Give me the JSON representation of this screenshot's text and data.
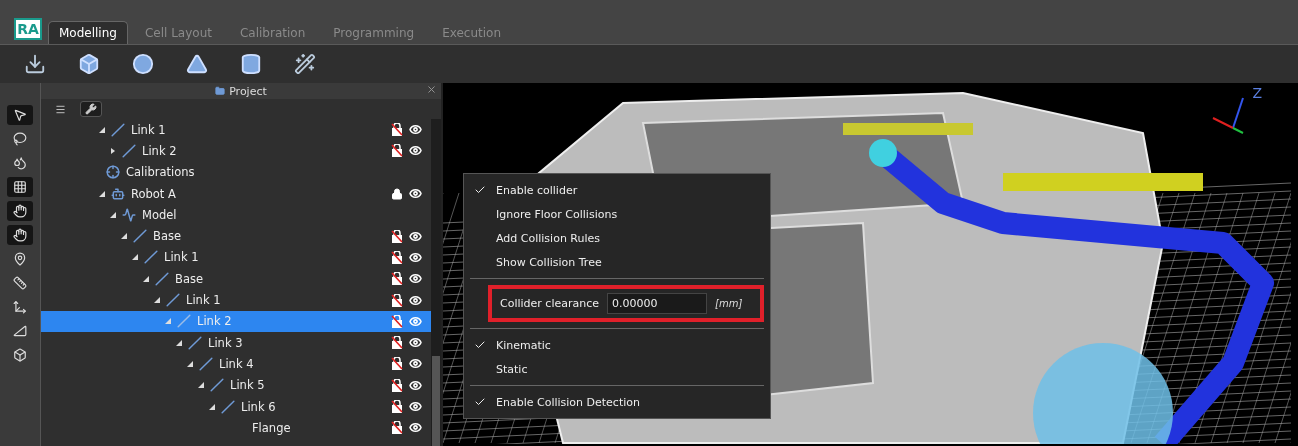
{
  "app": {
    "logo": "RA"
  },
  "tabs": [
    {
      "label": "Modelling",
      "selected": true
    },
    {
      "label": "Cell Layout",
      "selected": false
    },
    {
      "label": "Calibration",
      "selected": false
    },
    {
      "label": "Programming",
      "selected": false
    },
    {
      "label": "Execution",
      "selected": false
    }
  ],
  "toolbar": [
    {
      "kind": "import"
    },
    {
      "kind": "box"
    },
    {
      "kind": "sphere"
    },
    {
      "kind": "cone"
    },
    {
      "kind": "cylinder"
    },
    {
      "kind": "wand"
    }
  ],
  "side_tools": [
    {
      "kind": "pointer",
      "selected": true
    },
    {
      "kind": "lasso",
      "selected": false
    },
    {
      "kind": "blob",
      "selected": false
    },
    {
      "kind": "grid",
      "selected": true
    },
    {
      "kind": "hand",
      "selected": true
    },
    {
      "kind": "hand",
      "selected": true
    },
    {
      "kind": "pin",
      "selected": false
    },
    {
      "kind": "ruler",
      "selected": false
    },
    {
      "kind": "axes",
      "selected": false
    },
    {
      "kind": "angle",
      "selected": false
    },
    {
      "kind": "cube",
      "selected": false
    }
  ],
  "panel": {
    "title": "Project",
    "tree": [
      {
        "label": "Link 1",
        "kind": "link",
        "expanded": true,
        "locked": false,
        "visible": true,
        "selected": false,
        "children": [
          {
            "label": "Link 2",
            "kind": "link",
            "expanded": false,
            "locked": false,
            "visible": true,
            "selected": false
          }
        ]
      },
      {
        "label": "Calibrations",
        "kind": "calibration",
        "selected": false
      },
      {
        "label": "Robot A",
        "kind": "robot",
        "expanded": true,
        "locked": true,
        "visible": true,
        "selected": false,
        "children": [
          {
            "label": "Model",
            "kind": "model",
            "expanded": true,
            "selected": false,
            "children": [
              {
                "label": "Base",
                "kind": "link",
                "expanded": true,
                "locked": false,
                "visible": true,
                "selected": false,
                "children": [
                  {
                    "label": "Link 1",
                    "kind": "link",
                    "expanded": true,
                    "locked": false,
                    "visible": true,
                    "selected": false,
                    "children": [
                      {
                        "label": "Base",
                        "kind": "link",
                        "expanded": true,
                        "locked": false,
                        "visible": true,
                        "selected": false,
                        "children": [
                          {
                            "label": "Link 1",
                            "kind": "link",
                            "expanded": true,
                            "locked": false,
                            "visible": true,
                            "selected": false,
                            "children": [
                              {
                                "label": "Link 2",
                                "kind": "link",
                                "expanded": true,
                                "locked": false,
                                "visible": true,
                                "selected": true,
                                "children": [
                                  {
                                    "label": "Link 3",
                                    "kind": "link",
                                    "expanded": true,
                                    "locked": false,
                                    "visible": true,
                                    "selected": false,
                                    "children": [
                                      {
                                        "label": "Link 4",
                                        "kind": "link",
                                        "expanded": true,
                                        "locked": false,
                                        "visible": true,
                                        "selected": false,
                                        "children": [
                                          {
                                            "label": "Link 5",
                                            "kind": "link",
                                            "expanded": true,
                                            "locked": false,
                                            "visible": true,
                                            "selected": false,
                                            "children": [
                                              {
                                                "label": "Link 6",
                                                "kind": "link",
                                                "expanded": true,
                                                "locked": false,
                                                "visible": true,
                                                "selected": false,
                                                "children": [
                                                  {
                                                    "label": "Flange",
                                                    "locked": false,
                                                    "visible": true,
                                                    "selected": false
                                                  }
                                                ]
                                              }
                                            ]
                                          }
                                        ]
                                      }
                                    ]
                                  }
                                ]
                              }
                            ]
                          }
                        ]
                      }
                    ]
                  }
                ]
              }
            ]
          }
        ]
      }
    ]
  },
  "viewport": {
    "axis_label": "Z"
  },
  "context_menu": [
    {
      "kind": "check",
      "label": "Enable collider",
      "checked": true
    },
    {
      "kind": "check",
      "label": "Ignore Floor Collisions",
      "checked": false
    },
    {
      "kind": "check",
      "label": "Add Collision Rules",
      "checked": false
    },
    {
      "kind": "check",
      "label": "Show Collision Tree",
      "checked": false
    },
    {
      "kind": "separator"
    },
    {
      "kind": "field",
      "label": "Collider clearance",
      "value": "0.00000",
      "unit": "[mm]",
      "highlighted": true
    },
    {
      "kind": "separator"
    },
    {
      "kind": "check",
      "label": "Kinematic",
      "checked": true
    },
    {
      "kind": "check",
      "label": "Static",
      "checked": false
    },
    {
      "kind": "separator"
    },
    {
      "kind": "check",
      "label": "Enable Collision Detection",
      "checked": true
    }
  ]
}
